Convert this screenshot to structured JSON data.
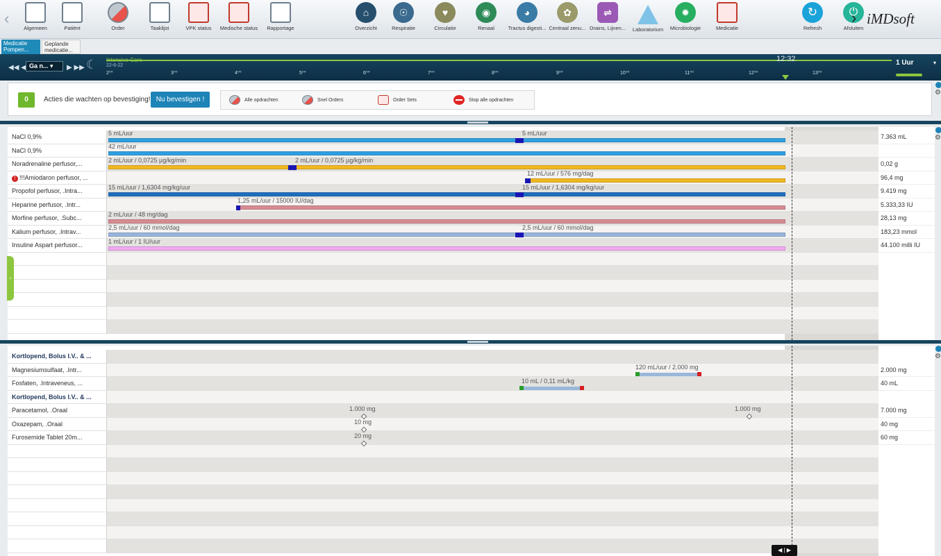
{
  "toolbar": {
    "items": [
      {
        "label": "Algemeen",
        "icon": "hospital-icon"
      },
      {
        "label": "Patiënt",
        "icon": "patient-bed-icon"
      },
      {
        "label": "Order",
        "icon": "pill-icon"
      },
      {
        "label": "Taaklijst",
        "icon": "checklist-icon"
      },
      {
        "label": "VPK status",
        "icon": "nurse-status-icon"
      },
      {
        "label": "Medische status",
        "icon": "medical-status-icon"
      },
      {
        "label": "Rapportage",
        "icon": "report-icon"
      },
      {
        "label": "Overzicht",
        "icon": "home-icon"
      },
      {
        "label": "Respiratie",
        "icon": "lungs-icon"
      },
      {
        "label": "Circulatie",
        "icon": "heart-icon"
      },
      {
        "label": "Renaal",
        "icon": "kidney-icon"
      },
      {
        "label": "Tractus digesti...",
        "icon": "stomach-icon"
      },
      {
        "label": "Centraal zenu...",
        "icon": "brain-icon"
      },
      {
        "label": "Drains, Lijnen...",
        "icon": "drains-icon"
      },
      {
        "label": "Laboratorium",
        "icon": "flask-icon"
      },
      {
        "label": "Microbiologie",
        "icon": "microbe-icon"
      },
      {
        "label": "Medicatie",
        "icon": "medication-icon"
      },
      {
        "label": "Refresh",
        "icon": "refresh-icon"
      },
      {
        "label": "Afsluiten",
        "icon": "power-icon"
      }
    ],
    "logo": "iMDsoft",
    "colors": {
      "overview": "#264f6e",
      "respiration": "#3a6a8e",
      "circulation": "#8a8a5c",
      "renal": "#2e8b57",
      "digestive": "#3a7ca5",
      "cns": "#9a9a6a",
      "drains": "#9b59b6",
      "microbio": "#27ae60"
    }
  },
  "tabs": [
    {
      "label": "Medicatie Pompen..."
    },
    {
      "label": "Geplande medicatie..."
    }
  ],
  "timebar": {
    "goto_label": "Ga n...",
    "unit": "Intensive Care",
    "date": "22-6-22",
    "hours": [
      "2⁰⁰",
      "3⁰⁰",
      "4⁰⁰",
      "5⁰⁰",
      "6⁰⁰",
      "7⁰⁰",
      "8⁰⁰",
      "9⁰⁰",
      "10⁰⁰",
      "11⁰⁰",
      "12⁰⁰",
      "13⁰⁰"
    ],
    "now": "12:32",
    "range": "1 Uur"
  },
  "actions": {
    "pending_count": "0",
    "pending_label": "Acties die wachten op bevestiging!",
    "confirm_label": "Nu bevestigen !",
    "commands": [
      "Alle opdrachten",
      "Snel Orders",
      "Order Sets",
      "Stop alle opdrachten"
    ]
  },
  "pumps": {
    "rows": [
      {
        "name": "NaCl 0,9%",
        "total": "7.363 mL",
        "warn": false
      },
      {
        "name": "NaCl 0,9%",
        "total": "",
        "warn": false
      },
      {
        "name": "Noradrenaline perfusor,...",
        "total": "0,02 g",
        "warn": false
      },
      {
        "name": "!!!Amiodaron perfusor, ...",
        "total": "96,4 mg",
        "warn": true
      },
      {
        "name": "Propofol perfusor, .Intra...",
        "total": "9.419 mg",
        "warn": false
      },
      {
        "name": "Heparine perfusor, .Intr...",
        "total": "5.333,33 IU",
        "warn": false
      },
      {
        "name": "Morfine perfusor, .Subc...",
        "total": "28,13 mg",
        "warn": false
      },
      {
        "name": "Kalium perfusor, .Intrav...",
        "total": "183,23 mmol",
        "warn": false
      },
      {
        "name": "Insuline Aspart perfusor...",
        "total": "44.100 milli IU",
        "warn": false
      }
    ],
    "bar_labels": [
      [
        "5 mL/uur",
        "5 mL/uur"
      ],
      [
        "42 mL/uur"
      ],
      [
        "2 mL/uur / 0,0725 µg/kg/min",
        "2 mL/uur / 0,0725 µg/kg/min"
      ],
      [
        "12 mL/uur / 576 mg/dag"
      ],
      [
        "15 mL/uur / 1,6304 mg/kg/uur",
        "15 mL/uur / 1,6304 mg/kg/uur"
      ],
      [
        "1,25 mL/uur / 15000 IU/dag"
      ],
      [
        "2 mL/uur / 48 mg/dag"
      ],
      [
        "2,5 mL/uur / 60 mmol/dag",
        "2,5 mL/uur / 60 mmol/dag"
      ],
      [
        "1 mL/uur / 1 IU/uur"
      ]
    ]
  },
  "orders": {
    "rows": [
      {
        "name": "Kortlopend, Bolus I.V.. & ...",
        "total": "",
        "header": true
      },
      {
        "name": "Magnesiumsulfaat, .Intr...",
        "total": "2.000 mg",
        "header": false
      },
      {
        "name": "Fosfaten, .Intraveneus, ...",
        "total": "40 mL",
        "header": false
      },
      {
        "name": "Kortlopend, Bolus I.V.. & ...",
        "total": "",
        "header": true
      },
      {
        "name": "Paracetamol, .Oraal",
        "total": "7.000 mg",
        "header": false
      },
      {
        "name": "Oxazepam, .Oraal",
        "total": "40 mg",
        "header": false
      },
      {
        "name": "Furosemide Tablet 20m...",
        "total": "60 mg",
        "header": false
      }
    ],
    "event_labels": {
      "magnesium": "120 mL/uur / 2.000 mg",
      "fosfaten": "10 mL / 0,11 mL/kg",
      "paracetamol_1": "1.000 mg",
      "paracetamol_2": "1.000 mg",
      "oxazepam": "10 mg",
      "furosemide": "20 mg"
    }
  }
}
